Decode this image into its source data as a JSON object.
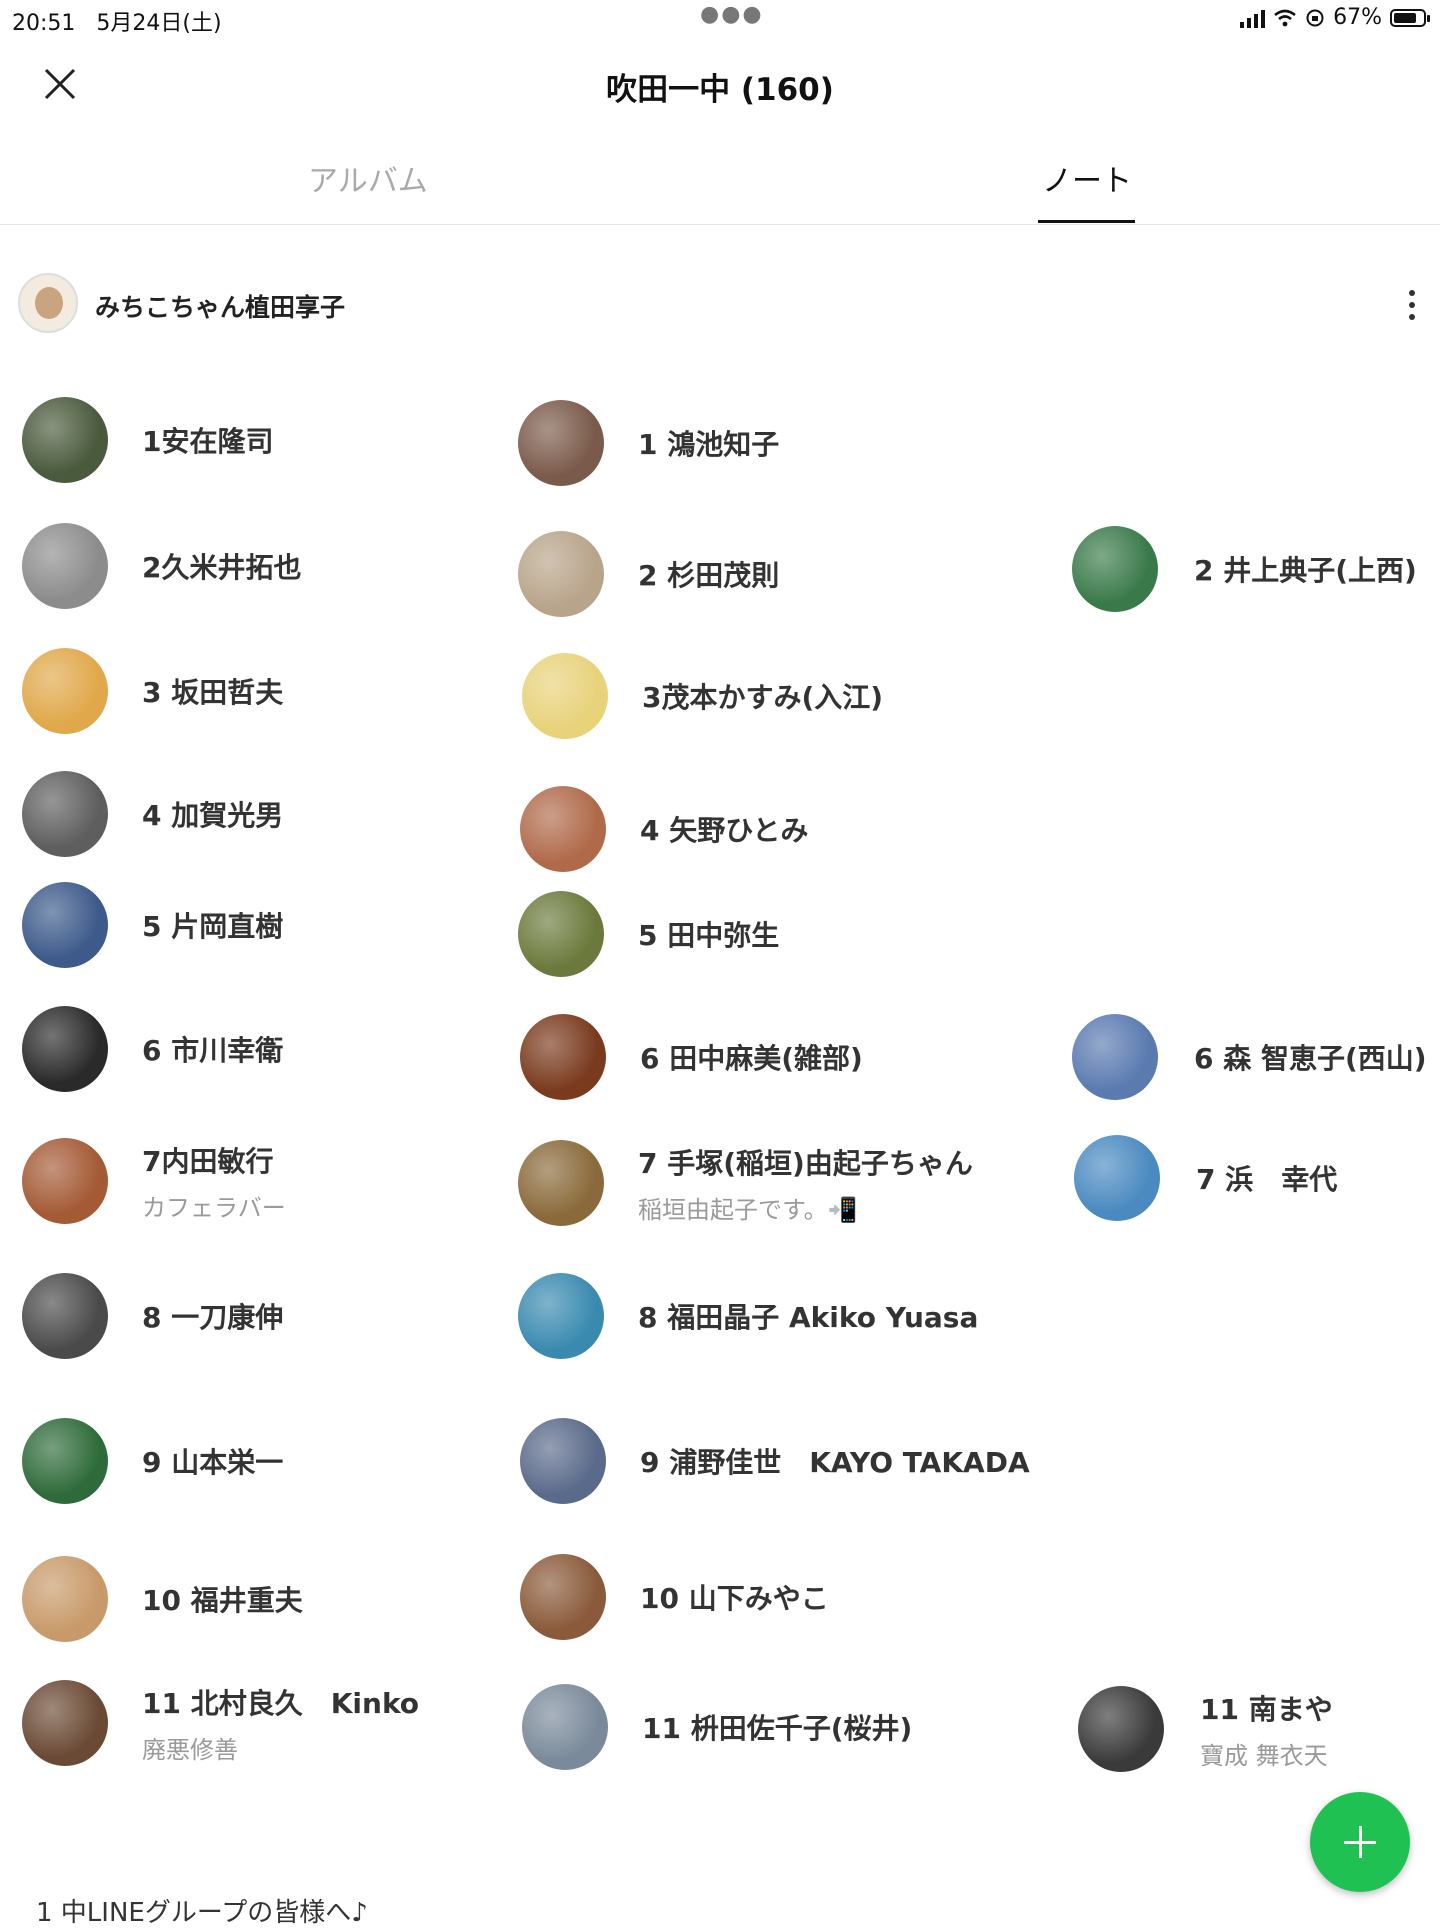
{
  "status_bar": {
    "time": "20:51",
    "date": "5月24日(土)",
    "battery": "67%"
  },
  "header": {
    "title": "吹田一中 (160)"
  },
  "tabs": [
    {
      "label": "アルバム",
      "active": false
    },
    {
      "label": "ノート",
      "active": true
    }
  ],
  "author": {
    "name": "みちこちゃん植田享子"
  },
  "members": {
    "c1": [
      {
        "name": "1安在隆司",
        "sub": "",
        "color": "#4a5a3c"
      },
      {
        "name": "2久米井拓也",
        "sub": "",
        "color": "#8c8c8c"
      },
      {
        "name": "3 坂田哲夫",
        "sub": "",
        "color": "#e0a84a"
      },
      {
        "name": "4 加賀光男",
        "sub": "",
        "color": "#5e5e5e"
      },
      {
        "name": "5 片岡直樹",
        "sub": "",
        "color": "#3c5a8a"
      },
      {
        "name": "6 市川幸衛",
        "sub": "",
        "color": "#2a2a2a"
      },
      {
        "name": "7内田敏行",
        "sub": "カフェラバー",
        "color": "#a45a35"
      },
      {
        "name": "8 一刀康伸",
        "sub": "",
        "color": "#4a4a4a"
      },
      {
        "name": "9 山本栄一",
        "sub": "",
        "color": "#2f6b3a"
      },
      {
        "name": "10 福井重夫",
        "sub": "",
        "color": "#c89a6a"
      },
      {
        "name": "11 北村良久　Kinko",
        "sub": "廃悪修善",
        "color": "#6b4a35"
      }
    ],
    "c2": [
      {
        "name": "1 鴻池知子",
        "sub": "",
        "color": "#7a5a4a"
      },
      {
        "name": "2 杉田茂則",
        "sub": "",
        "color": "#b8a48a"
      },
      {
        "name": "3茂本かすみ(入江)",
        "sub": "",
        "color": "#e8d27a"
      },
      {
        "name": "4 矢野ひとみ",
        "sub": "",
        "color": "#b06a4a"
      },
      {
        "name": "5 田中弥生",
        "sub": "",
        "color": "#6b7a3c"
      },
      {
        "name": "6 田中麻美(雑部)",
        "sub": "",
        "color": "#7a3a1e"
      },
      {
        "name": "7 手塚(稲垣)由起子ちゃん",
        "sub": "稲垣由起子です。📲",
        "color": "#8a6a3a"
      },
      {
        "name": "8 福田晶子 Akiko Yuasa",
        "sub": "",
        "color": "#3a8ab0"
      },
      {
        "name": "9 浦野佳世　KAYO  TAKADA",
        "sub": "",
        "color": "#5a6a8a"
      },
      {
        "name": "10 山下みやこ",
        "sub": "",
        "color": "#8a5a3a"
      },
      {
        "name": "11 枡田佐千子(桜井)",
        "sub": "",
        "color": "#7a8a9a"
      }
    ],
    "c3": [
      {
        "name": "2 井上典子(上西)",
        "sub": "",
        "color": "#3a7a4a"
      },
      {
        "name": "6 森 智恵子(西山)",
        "sub": "",
        "color": "#5a7ab0"
      },
      {
        "name": "7 浜　幸代",
        "sub": "",
        "color": "#4a8ac0"
      },
      {
        "name": "11 南まや",
        "sub": "寶成 舞衣天",
        "color": "#3a3a3a"
      }
    ]
  },
  "footer": {
    "text": "1 中LINEグループの皆様へ♪"
  }
}
